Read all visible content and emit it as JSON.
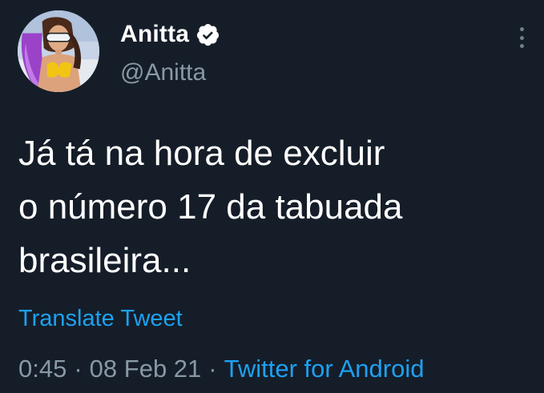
{
  "tweet": {
    "author": {
      "display_name": "Anitta",
      "handle": "@Anitta",
      "verified_icon": "verified-badge-icon",
      "avatar_icon": "profile-photo"
    },
    "text": "Já tá na hora de excluir\no número 17 da tabuada\nbrasileira...",
    "translate_label": "Translate Tweet",
    "time": "0:45",
    "date": "08 Feb 21",
    "separator": "·",
    "source": "Twitter for Android",
    "more_icon": "more-vertical-icon"
  },
  "colors": {
    "background": "#151d28",
    "text_primary": "#ffffff",
    "text_secondary": "#8899a6",
    "accent": "#1da1f2"
  }
}
